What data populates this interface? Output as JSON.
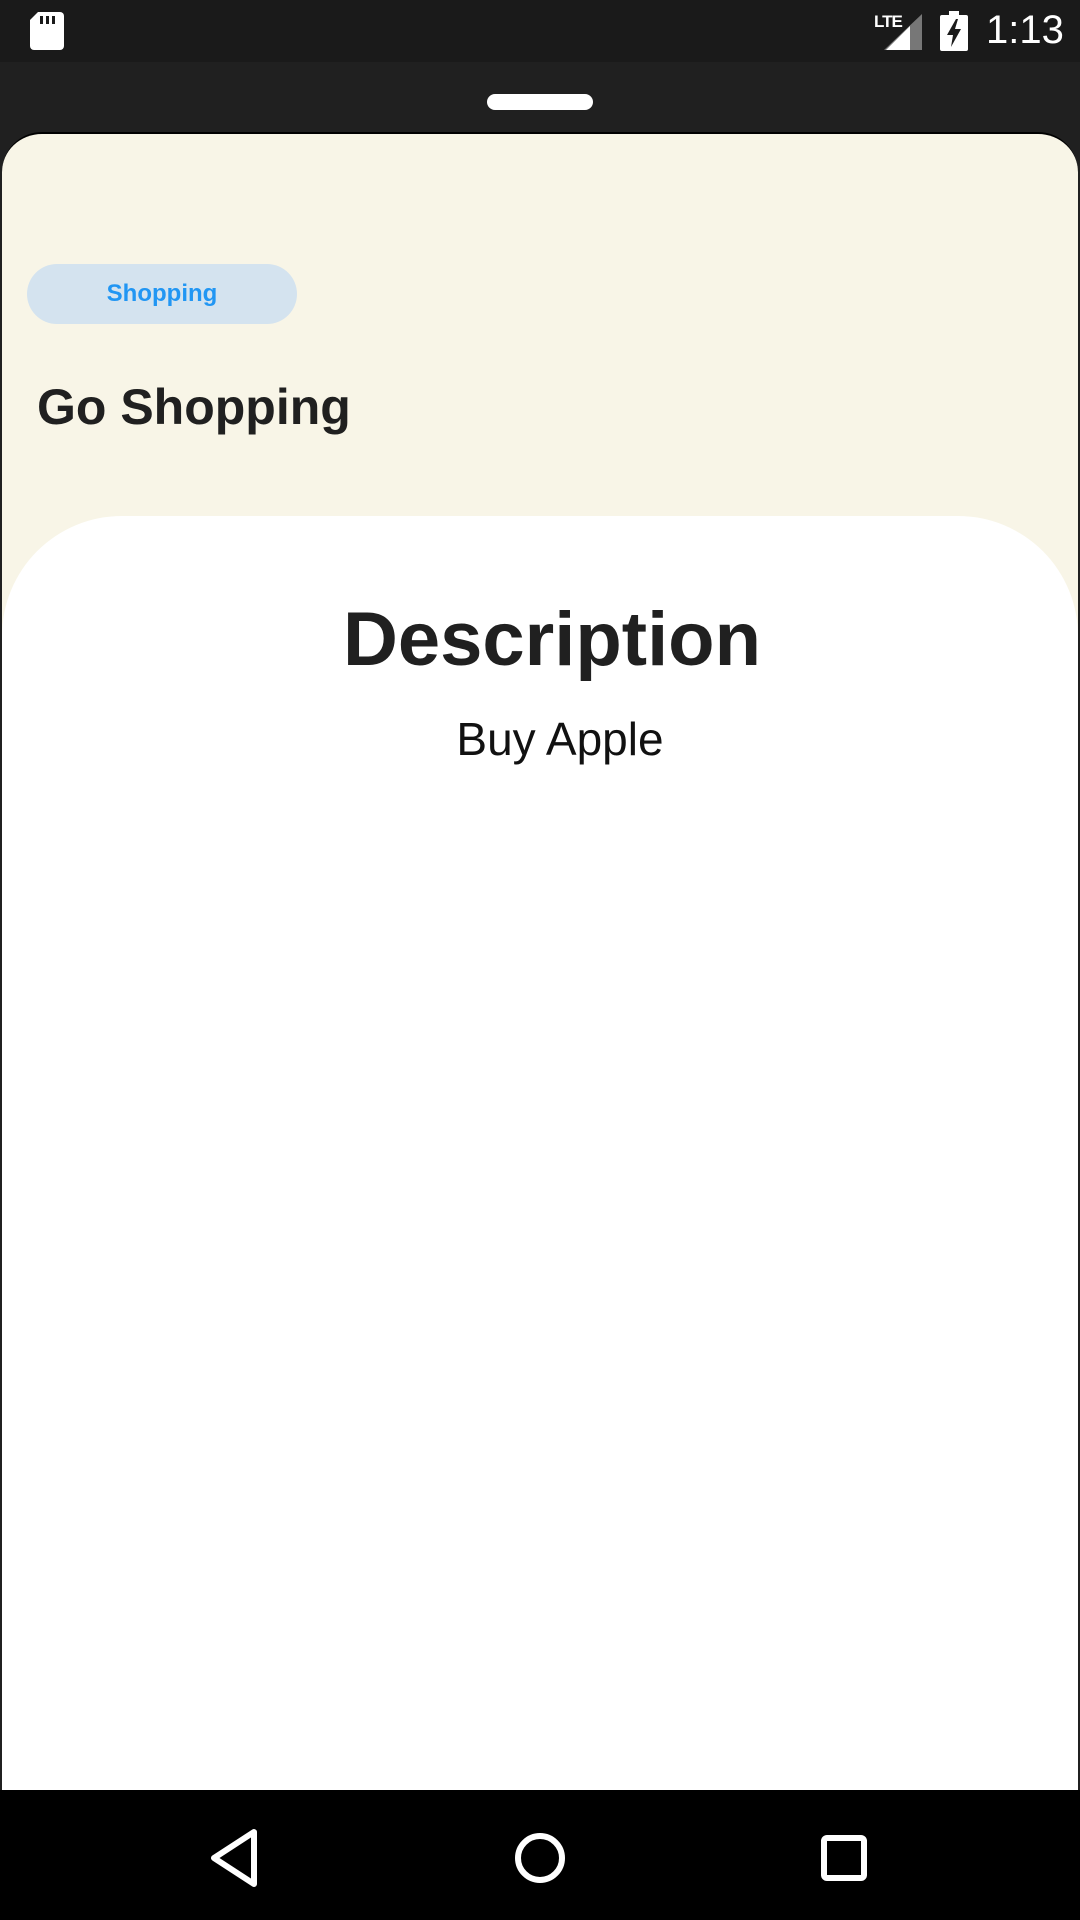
{
  "status_bar": {
    "network": "LTE",
    "time": "1:13"
  },
  "task": {
    "category": "Shopping",
    "title": "Go Shopping",
    "description_heading": "Description",
    "description": "Buy Apple"
  },
  "colors": {
    "sheet_background": "#f8f5e7",
    "chip_background": "#d4e3ef",
    "chip_text": "#2196f3"
  },
  "icons": {
    "status": [
      "sd-card-icon",
      "signal-icon",
      "battery-charging-icon"
    ],
    "navigation": [
      "back-icon",
      "home-icon",
      "recents-icon"
    ]
  }
}
